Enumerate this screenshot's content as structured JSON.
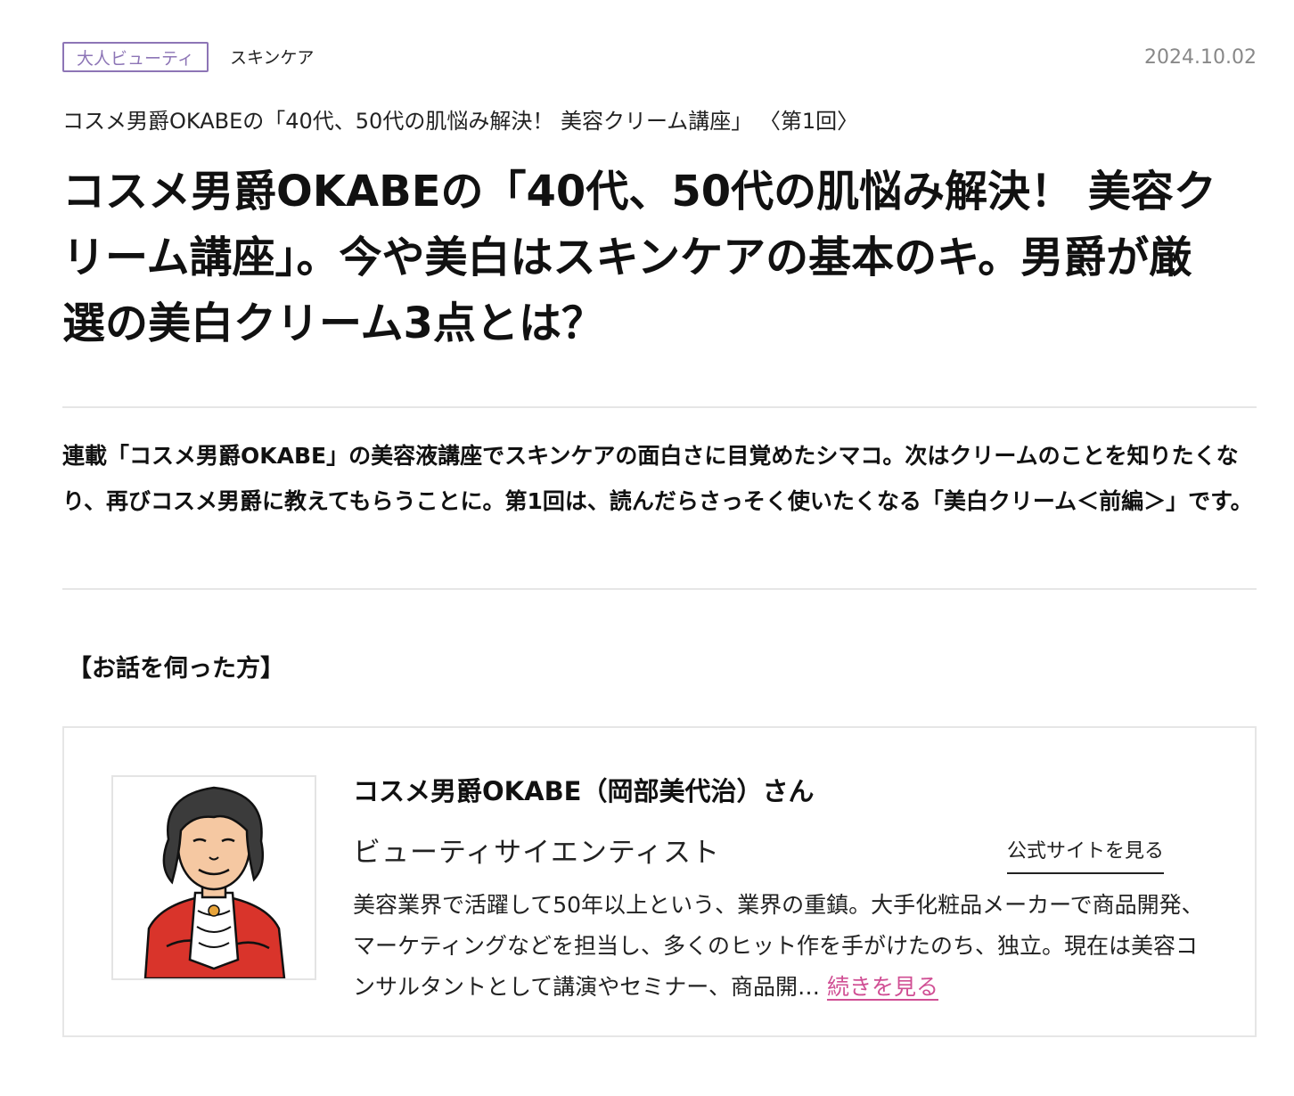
{
  "meta": {
    "tag_label": "大人ビューティ",
    "category": "スキンケア",
    "date": "2024.10.02",
    "accent_color": "#8d75b6"
  },
  "article": {
    "series": "コスメ男爵OKABEの「40代、50代の肌悩み解決！ 美容クリーム講座」 〈第1回〉",
    "title": "コスメ男爵OKABEの「40代、50代の肌悩み解決！ 美容クリーム講座」。今や美白はスキンケアの基本のキ。男爵が厳選の美白クリーム3点とは？",
    "lead": "連載「コスメ男爵OKABE」の美容液講座でスキンケアの面白さに目覚めたシマコ。次はクリームのことを知りたくなり、再びコスメ男爵に教えてもらうことに。第1回は、読んだらさっそく使いたくなる「美白クリーム＜前編＞」です。"
  },
  "profile": {
    "section_heading": "【お話を伺った方】",
    "name": "コスメ男爵OKABE（岡部美代治）さん",
    "role": "ビューティサイエンティスト",
    "official_link": "公式サイトを見る",
    "bio": "美容業界で活躍して50年以上という、業界の重鎮。大手化粧品メーカーで商品開発、マーケティングなどを担当し、多くのヒット作を手がけたのち、独立。現在は美容コンサルタントとして講演やセミナー、商品開…",
    "read_more": "続きを見る",
    "link_color": "#d04f94",
    "avatar_icon": "illustrated-portrait"
  }
}
